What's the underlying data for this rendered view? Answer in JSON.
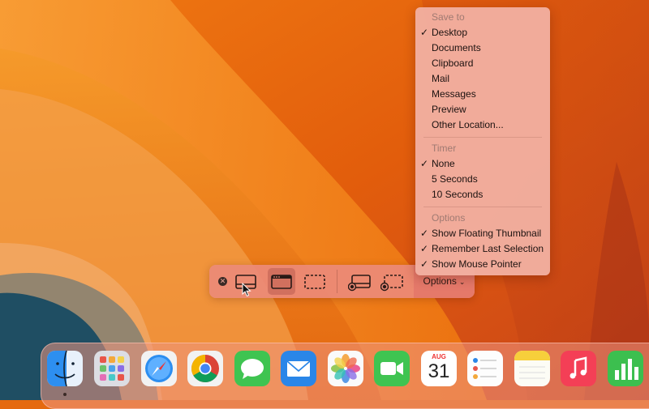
{
  "toolbar": {
    "options_label": "Options"
  },
  "menu": {
    "sections": [
      {
        "header": "Save to",
        "items": [
          {
            "label": "Desktop",
            "checked": true
          },
          {
            "label": "Documents",
            "checked": false
          },
          {
            "label": "Clipboard",
            "checked": false
          },
          {
            "label": "Mail",
            "checked": false
          },
          {
            "label": "Messages",
            "checked": false
          },
          {
            "label": "Preview",
            "checked": false
          },
          {
            "label": "Other Location...",
            "checked": false
          }
        ]
      },
      {
        "header": "Timer",
        "items": [
          {
            "label": "None",
            "checked": true
          },
          {
            "label": "5 Seconds",
            "checked": false
          },
          {
            "label": "10 Seconds",
            "checked": false
          }
        ]
      },
      {
        "header": "Options",
        "items": [
          {
            "label": "Show Floating Thumbnail",
            "checked": true
          },
          {
            "label": "Remember Last Selection",
            "checked": true
          },
          {
            "label": "Show Mouse Pointer",
            "checked": true
          }
        ]
      }
    ]
  },
  "dock": {
    "apps": [
      "finder-icon",
      "launchpad-icon",
      "safari-icon",
      "chrome-icon",
      "messages-icon",
      "mail-icon",
      "photos-icon",
      "facetime-icon",
      "calendar-icon",
      "reminders-icon",
      "notes-icon",
      "music-icon",
      "numbers-icon"
    ],
    "calendar_month": "AUG",
    "calendar_day": "31"
  },
  "colors": {
    "wallpaper_orange": "#e56a10",
    "menu_bg": "#f1afa0",
    "toolbar_bg": "#ec8a78"
  }
}
